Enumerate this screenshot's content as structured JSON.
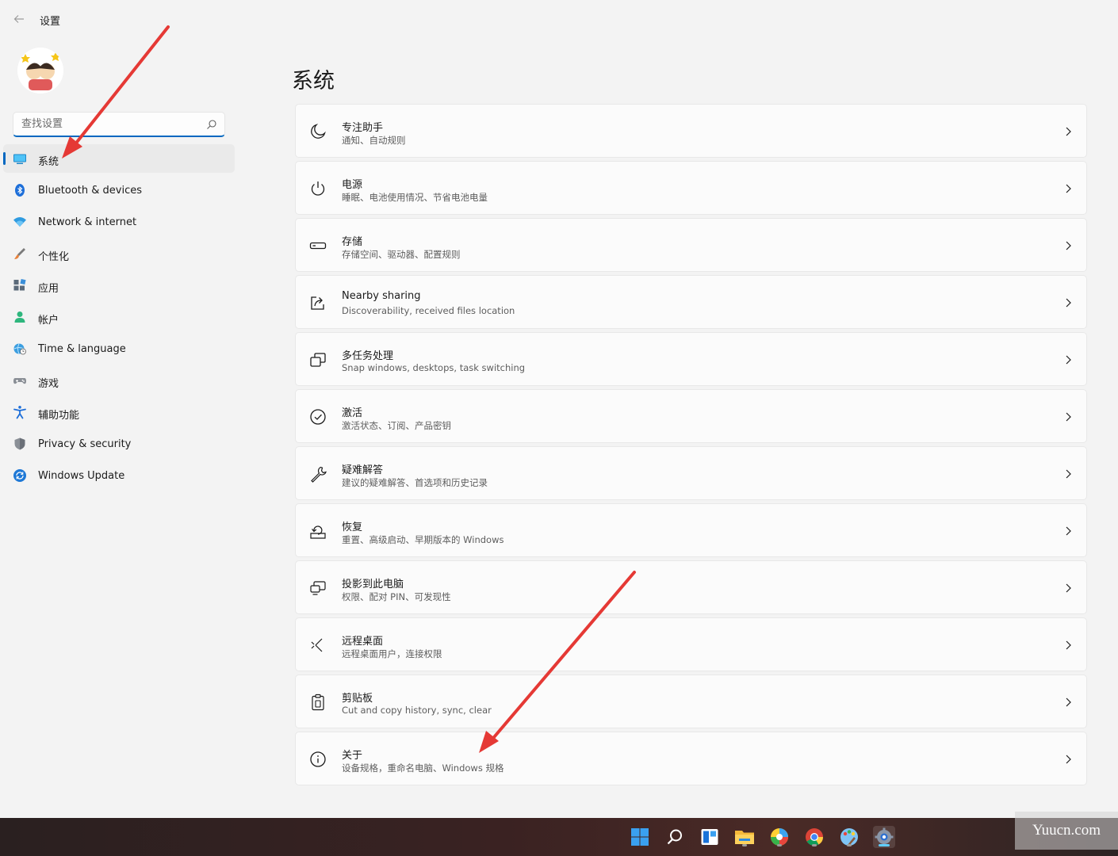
{
  "window": {
    "title": "设置"
  },
  "search": {
    "placeholder": "查找设置"
  },
  "sidebar": {
    "items": [
      {
        "label": "系统",
        "icon": "monitor-icon",
        "active": true
      },
      {
        "label": "Bluetooth & devices",
        "icon": "bluetooth-icon",
        "active": false
      },
      {
        "label": "Network & internet",
        "icon": "wifi-icon",
        "active": false
      },
      {
        "label": "个性化",
        "icon": "brush-icon",
        "active": false
      },
      {
        "label": "应用",
        "icon": "apps-icon",
        "active": false
      },
      {
        "label": "帐户",
        "icon": "person-icon",
        "active": false
      },
      {
        "label": "Time & language",
        "icon": "globe-clock-icon",
        "active": false
      },
      {
        "label": "游戏",
        "icon": "gamepad-icon",
        "active": false
      },
      {
        "label": "辅助功能",
        "icon": "accessibility-icon",
        "active": false
      },
      {
        "label": "Privacy & security",
        "icon": "shield-icon",
        "active": false
      },
      {
        "label": "Windows Update",
        "icon": "update-icon",
        "active": false
      }
    ]
  },
  "main": {
    "title": "系统",
    "cards": [
      {
        "title": "专注助手",
        "subtitle": "通知、自动规则",
        "icon": "moon-icon"
      },
      {
        "title": "电源",
        "subtitle": "睡眠、电池使用情况、节省电池电量",
        "icon": "power-icon"
      },
      {
        "title": "存储",
        "subtitle": "存储空间、驱动器、配置规则",
        "icon": "storage-icon"
      },
      {
        "title": "Nearby sharing",
        "subtitle": "Discoverability, received files location",
        "icon": "share-icon"
      },
      {
        "title": "多任务处理",
        "subtitle": "Snap windows, desktops, task switching",
        "icon": "multitask-icon"
      },
      {
        "title": "激活",
        "subtitle": "激活状态、订阅、产品密钥",
        "icon": "check-circle-icon"
      },
      {
        "title": "疑难解答",
        "subtitle": "建议的疑难解答、首选项和历史记录",
        "icon": "wrench-icon"
      },
      {
        "title": "恢复",
        "subtitle": "重置、高级启动、早期版本的 Windows",
        "icon": "recovery-icon"
      },
      {
        "title": "投影到此电脑",
        "subtitle": "权限、配对 PIN、可发现性",
        "icon": "projection-icon"
      },
      {
        "title": "远程桌面",
        "subtitle": "远程桌面用户，连接权限",
        "icon": "remote-icon"
      },
      {
        "title": "剪贴板",
        "subtitle": "Cut and copy history, sync, clear",
        "icon": "clipboard-icon"
      },
      {
        "title": "关于",
        "subtitle": "设备规格，重命名电脑、Windows 规格",
        "icon": "info-icon"
      }
    ]
  },
  "taskbar": {
    "icons": [
      "start-icon",
      "search-icon",
      "widgets-icon",
      "file-explorer-icon",
      "photos-icon",
      "chrome-icon",
      "paint-icon",
      "settings-icon"
    ]
  },
  "watermark": {
    "text": "Yuucn.com"
  },
  "colors": {
    "accent": "#0067c0",
    "arrow": "#e53935"
  }
}
